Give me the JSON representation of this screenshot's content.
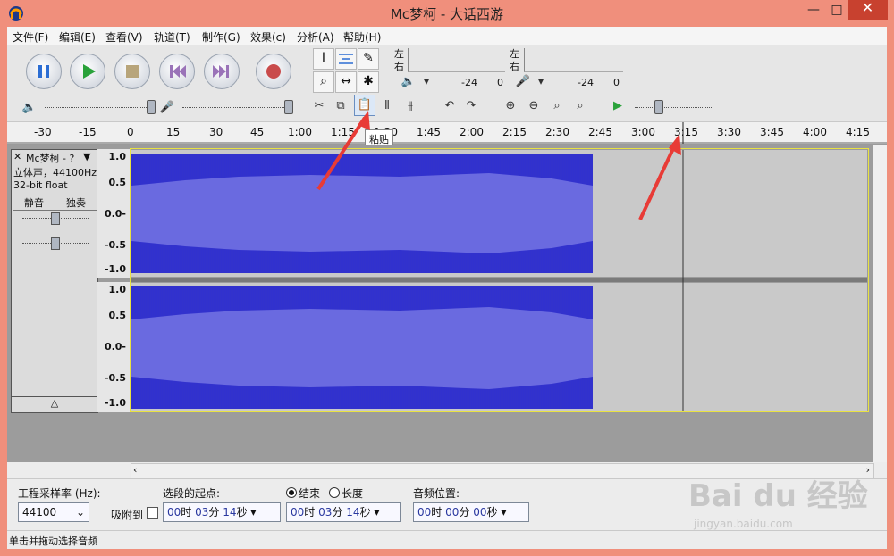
{
  "window": {
    "title": "Mc梦柯 - 大话西游"
  },
  "menu": [
    "文件(F)",
    "编辑(E)",
    "查看(V)",
    "轨道(T)",
    "制作(G)",
    "效果(c)",
    "分析(A)",
    "帮助(H)"
  ],
  "meters": {
    "left": "左",
    "right": "右",
    "db1": "-24",
    "db2": "0",
    "db3": "-24",
    "db4": "0"
  },
  "ruler": [
    "-30",
    "-15",
    "0",
    "15",
    "30",
    "45",
    "1:00",
    "1:15",
    "1:30",
    "1:45",
    "2:00",
    "2:15",
    "2:30",
    "2:45",
    "3:00",
    "3:15",
    "3:30",
    "3:45",
    "4:00",
    "4:15"
  ],
  "tooltip": "粘贴",
  "track": {
    "name": "Mc梦柯 - ?",
    "info_line1": "立体声，44100Hz",
    "info_line2": "32-bit float",
    "mute": "静音",
    "solo": "独奏",
    "axis_top": [
      "1.0",
      "0.5",
      "0.0-",
      "-0.5",
      "-1.0"
    ],
    "axis_bottom": [
      "1.0",
      "0.5",
      "0.0-",
      "-0.5",
      "-1.0"
    ]
  },
  "bottom": {
    "rate_label": "工程采样率 (Hz):",
    "rate_value": "44100",
    "snap_label": "吸附到",
    "sel_start_label": "选段的起点:",
    "end_label": "结束",
    "length_label": "长度",
    "audio_pos_label": "音频位置:",
    "time_zero": "00",
    "hr": "时",
    "min": "分",
    "sec": "秒",
    "start_min": "03",
    "start_sec": "14",
    "end_min": "03",
    "end_sec": "14",
    "pos_min": "00",
    "pos_sec": "00"
  },
  "status": "单击并拖动选择音频",
  "watermark": "Bai du 经验",
  "watermark_url": "jingyan.baidu.com"
}
